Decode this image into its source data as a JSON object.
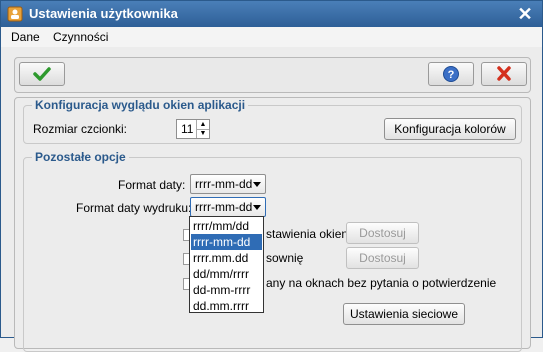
{
  "window": {
    "title": "Ustawienia użytkownika"
  },
  "menu": {
    "items": [
      "Dane",
      "Czynności"
    ]
  },
  "appearance": {
    "legend": "Konfiguracja wyglądu okien aplikacji",
    "font_size_label": "Rozmiar czcionki:",
    "font_size_value": "11",
    "colors_button": "Konfiguracja kolorów"
  },
  "other": {
    "legend": "Pozostałe opcje",
    "date_format_label": "Format daty:",
    "date_format_value": "rrrr-mm-dd",
    "print_date_format_label": "Format daty wydruku:",
    "print_date_format_value": "rrrr-mm-dd",
    "window_settings_text": "stawienia okien",
    "customize_button_1": "Dostosuj",
    "second_option_text": "sownię",
    "customize_button_2": "Dostosuj",
    "third_option_text": "any na oknach bez pytania o potwierdzenie",
    "network_settings_button": "Ustawienia sieciowe"
  },
  "dropdown": {
    "options": [
      "rrrr/mm/dd",
      "rrrr-mm-dd",
      "rrrr.mm.dd",
      "dd/mm/rrrr",
      "dd-mm-rrrr",
      "dd.mm.rrrr"
    ],
    "selected_index": 1
  },
  "colors": {
    "title_bar": "#3a6ea8",
    "legend_text": "#2b5a8c",
    "selection": "#2f6cb5"
  }
}
